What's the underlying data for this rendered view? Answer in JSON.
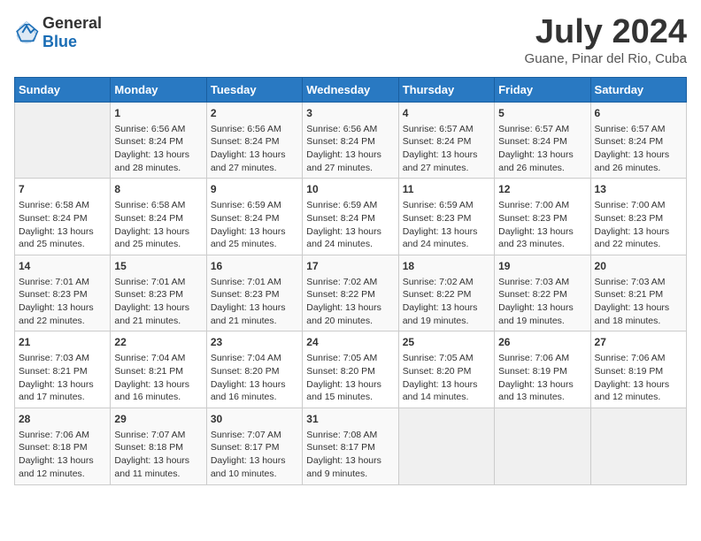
{
  "header": {
    "logo_general": "General",
    "logo_blue": "Blue",
    "title": "July 2024",
    "subtitle": "Guane, Pinar del Rio, Cuba"
  },
  "calendar": {
    "days_of_week": [
      "Sunday",
      "Monday",
      "Tuesday",
      "Wednesday",
      "Thursday",
      "Friday",
      "Saturday"
    ],
    "weeks": [
      [
        {
          "day": "",
          "content": ""
        },
        {
          "day": "1",
          "content": "Sunrise: 6:56 AM\nSunset: 8:24 PM\nDaylight: 13 hours and 28 minutes."
        },
        {
          "day": "2",
          "content": "Sunrise: 6:56 AM\nSunset: 8:24 PM\nDaylight: 13 hours and 27 minutes."
        },
        {
          "day": "3",
          "content": "Sunrise: 6:56 AM\nSunset: 8:24 PM\nDaylight: 13 hours and 27 minutes."
        },
        {
          "day": "4",
          "content": "Sunrise: 6:57 AM\nSunset: 8:24 PM\nDaylight: 13 hours and 27 minutes."
        },
        {
          "day": "5",
          "content": "Sunrise: 6:57 AM\nSunset: 8:24 PM\nDaylight: 13 hours and 26 minutes."
        },
        {
          "day": "6",
          "content": "Sunrise: 6:57 AM\nSunset: 8:24 PM\nDaylight: 13 hours and 26 minutes."
        }
      ],
      [
        {
          "day": "7",
          "content": "Sunrise: 6:58 AM\nSunset: 8:24 PM\nDaylight: 13 hours and 25 minutes."
        },
        {
          "day": "8",
          "content": "Sunrise: 6:58 AM\nSunset: 8:24 PM\nDaylight: 13 hours and 25 minutes."
        },
        {
          "day": "9",
          "content": "Sunrise: 6:59 AM\nSunset: 8:24 PM\nDaylight: 13 hours and 25 minutes."
        },
        {
          "day": "10",
          "content": "Sunrise: 6:59 AM\nSunset: 8:24 PM\nDaylight: 13 hours and 24 minutes."
        },
        {
          "day": "11",
          "content": "Sunrise: 6:59 AM\nSunset: 8:23 PM\nDaylight: 13 hours and 24 minutes."
        },
        {
          "day": "12",
          "content": "Sunrise: 7:00 AM\nSunset: 8:23 PM\nDaylight: 13 hours and 23 minutes."
        },
        {
          "day": "13",
          "content": "Sunrise: 7:00 AM\nSunset: 8:23 PM\nDaylight: 13 hours and 22 minutes."
        }
      ],
      [
        {
          "day": "14",
          "content": "Sunrise: 7:01 AM\nSunset: 8:23 PM\nDaylight: 13 hours and 22 minutes."
        },
        {
          "day": "15",
          "content": "Sunrise: 7:01 AM\nSunset: 8:23 PM\nDaylight: 13 hours and 21 minutes."
        },
        {
          "day": "16",
          "content": "Sunrise: 7:01 AM\nSunset: 8:23 PM\nDaylight: 13 hours and 21 minutes."
        },
        {
          "day": "17",
          "content": "Sunrise: 7:02 AM\nSunset: 8:22 PM\nDaylight: 13 hours and 20 minutes."
        },
        {
          "day": "18",
          "content": "Sunrise: 7:02 AM\nSunset: 8:22 PM\nDaylight: 13 hours and 19 minutes."
        },
        {
          "day": "19",
          "content": "Sunrise: 7:03 AM\nSunset: 8:22 PM\nDaylight: 13 hours and 19 minutes."
        },
        {
          "day": "20",
          "content": "Sunrise: 7:03 AM\nSunset: 8:21 PM\nDaylight: 13 hours and 18 minutes."
        }
      ],
      [
        {
          "day": "21",
          "content": "Sunrise: 7:03 AM\nSunset: 8:21 PM\nDaylight: 13 hours and 17 minutes."
        },
        {
          "day": "22",
          "content": "Sunrise: 7:04 AM\nSunset: 8:21 PM\nDaylight: 13 hours and 16 minutes."
        },
        {
          "day": "23",
          "content": "Sunrise: 7:04 AM\nSunset: 8:20 PM\nDaylight: 13 hours and 16 minutes."
        },
        {
          "day": "24",
          "content": "Sunrise: 7:05 AM\nSunset: 8:20 PM\nDaylight: 13 hours and 15 minutes."
        },
        {
          "day": "25",
          "content": "Sunrise: 7:05 AM\nSunset: 8:20 PM\nDaylight: 13 hours and 14 minutes."
        },
        {
          "day": "26",
          "content": "Sunrise: 7:06 AM\nSunset: 8:19 PM\nDaylight: 13 hours and 13 minutes."
        },
        {
          "day": "27",
          "content": "Sunrise: 7:06 AM\nSunset: 8:19 PM\nDaylight: 13 hours and 12 minutes."
        }
      ],
      [
        {
          "day": "28",
          "content": "Sunrise: 7:06 AM\nSunset: 8:18 PM\nDaylight: 13 hours and 12 minutes."
        },
        {
          "day": "29",
          "content": "Sunrise: 7:07 AM\nSunset: 8:18 PM\nDaylight: 13 hours and 11 minutes."
        },
        {
          "day": "30",
          "content": "Sunrise: 7:07 AM\nSunset: 8:17 PM\nDaylight: 13 hours and 10 minutes."
        },
        {
          "day": "31",
          "content": "Sunrise: 7:08 AM\nSunset: 8:17 PM\nDaylight: 13 hours and 9 minutes."
        },
        {
          "day": "",
          "content": ""
        },
        {
          "day": "",
          "content": ""
        },
        {
          "day": "",
          "content": ""
        }
      ]
    ]
  }
}
